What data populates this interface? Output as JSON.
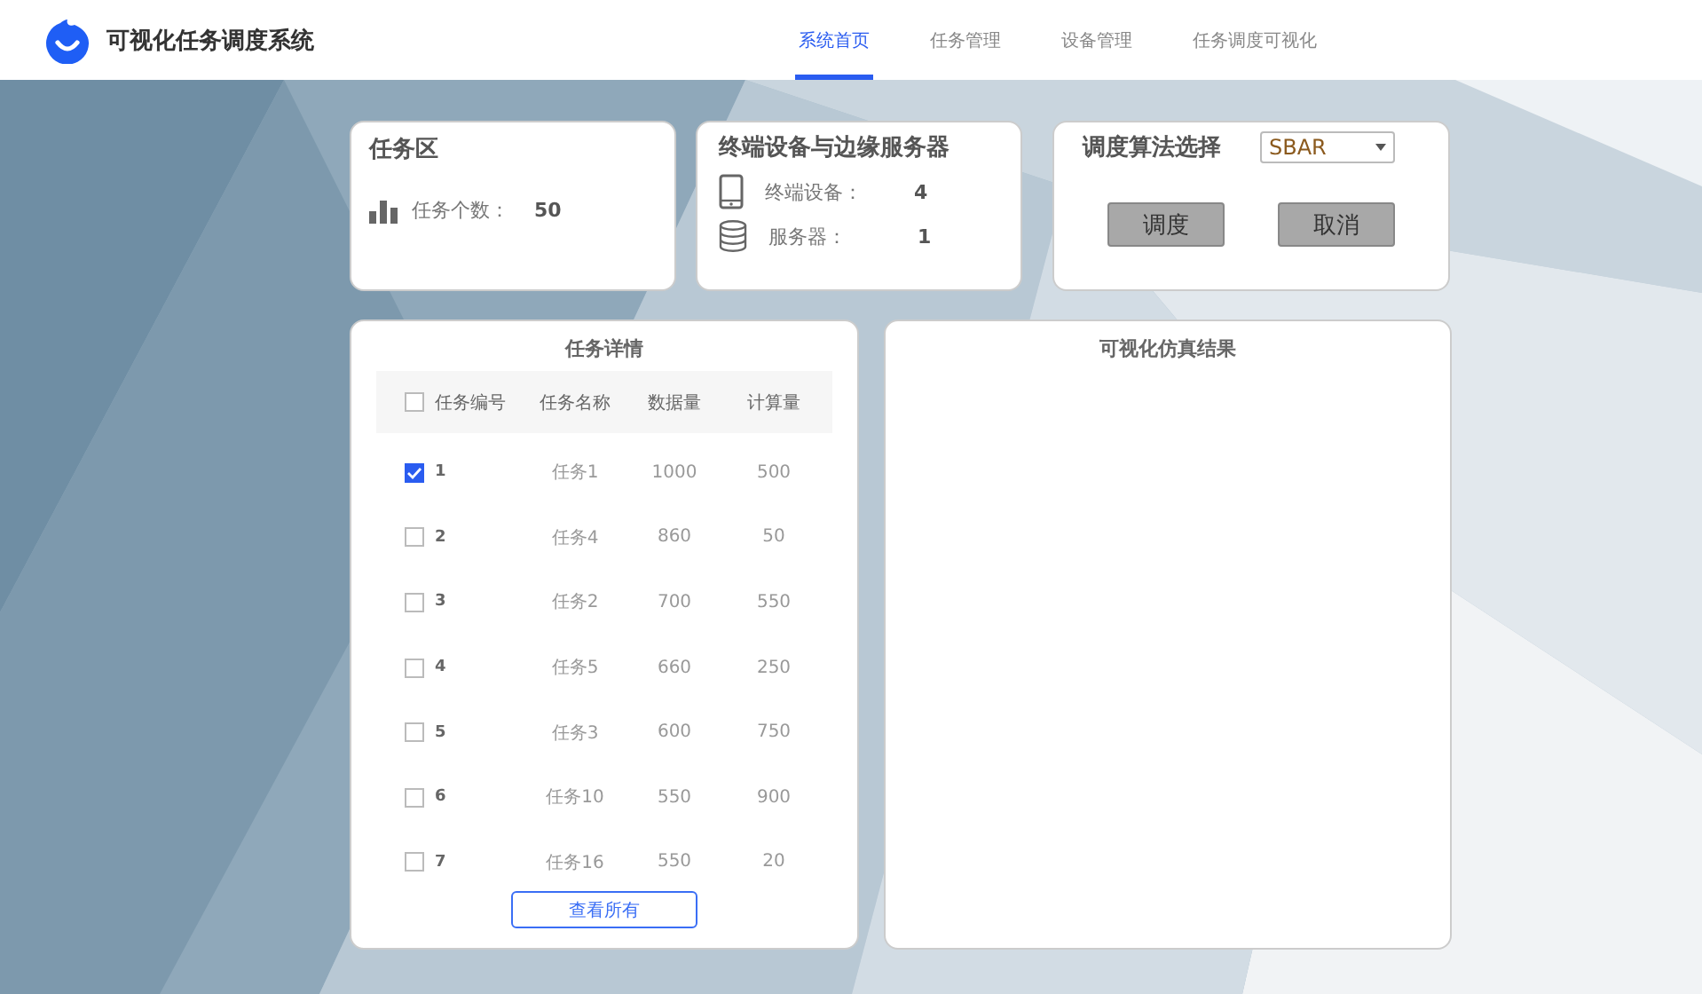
{
  "app": {
    "title": "可视化任务调度系统"
  },
  "nav": [
    {
      "label": "系统首页",
      "selected": true
    },
    {
      "label": "任务管理",
      "selected": false
    },
    {
      "label": "设备管理",
      "selected": false
    },
    {
      "label": "任务调度可视化",
      "selected": false
    }
  ],
  "task_area": {
    "title": "任务区",
    "label": "任务个数：",
    "value": "50"
  },
  "devices": {
    "title": "终端设备与边缘服务器",
    "items": [
      {
        "kind": "phone",
        "label": "终端设备：",
        "value": "4"
      },
      {
        "kind": "database",
        "label": "服务器：",
        "value": "1"
      }
    ]
  },
  "algorithm": {
    "title": "调度算法选择",
    "select": "SBAR",
    "buttons": [
      "调度",
      "取消"
    ]
  },
  "task_details": {
    "title": "任务详情",
    "all_checked": false,
    "columns": [
      "任务编号",
      "任务名称",
      "数据量",
      "计算量"
    ],
    "rows": [
      {
        "checked": true,
        "cells": [
          "1",
          "任务1",
          "1000",
          "500"
        ]
      },
      {
        "checked": false,
        "cells": [
          "2",
          "任务4",
          "860",
          "50"
        ]
      },
      {
        "checked": false,
        "cells": [
          "3",
          "任务2",
          "700",
          "550"
        ]
      },
      {
        "checked": false,
        "cells": [
          "4",
          "任务5",
          "660",
          "250"
        ]
      },
      {
        "checked": false,
        "cells": [
          "5",
          "任务3",
          "600",
          "750"
        ]
      },
      {
        "checked": false,
        "cells": [
          "6",
          "任务10",
          "550",
          "900"
        ]
      },
      {
        "checked": false,
        "cells": [
          "7",
          "任务16",
          "550",
          "20"
        ]
      }
    ],
    "button": "查看所有"
  },
  "simulation": {
    "title": "可视化仿真结果"
  }
}
